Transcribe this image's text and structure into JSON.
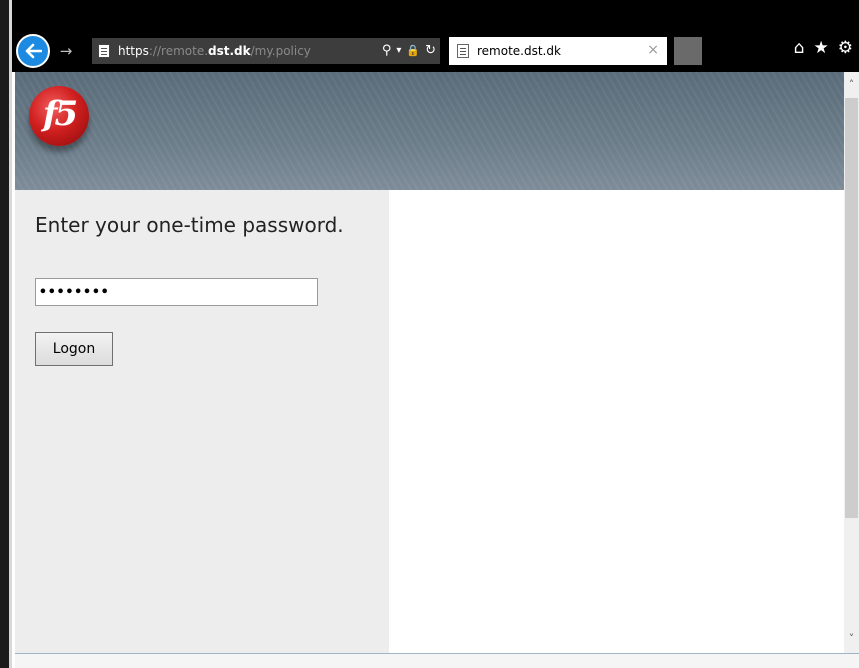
{
  "browser": {
    "address": {
      "scheme": "https",
      "separator": "://",
      "subdomain": "remote.",
      "domain": "dst.dk",
      "path": "/my.policy"
    },
    "address_tools": {
      "search": "⚲",
      "dropdown": "▾",
      "lock": "🔒",
      "refresh": "↻"
    },
    "tab": {
      "title": "remote.dst.dk",
      "close": "×"
    },
    "toolbar": {
      "home": "⌂",
      "favorites": "★",
      "settings": "⚙"
    },
    "forward": "→"
  },
  "page": {
    "logo_text": "f5",
    "heading": "Enter your one-time password.",
    "password_value": "••••••••",
    "logon_label": "Logon"
  },
  "scrollbar": {
    "up": "˄",
    "down": "˅"
  },
  "colors": {
    "chrome_bg": "#000000",
    "back_button": "#1c8ae0",
    "banner": "#6c7d8a",
    "left_panel": "#ededed"
  }
}
